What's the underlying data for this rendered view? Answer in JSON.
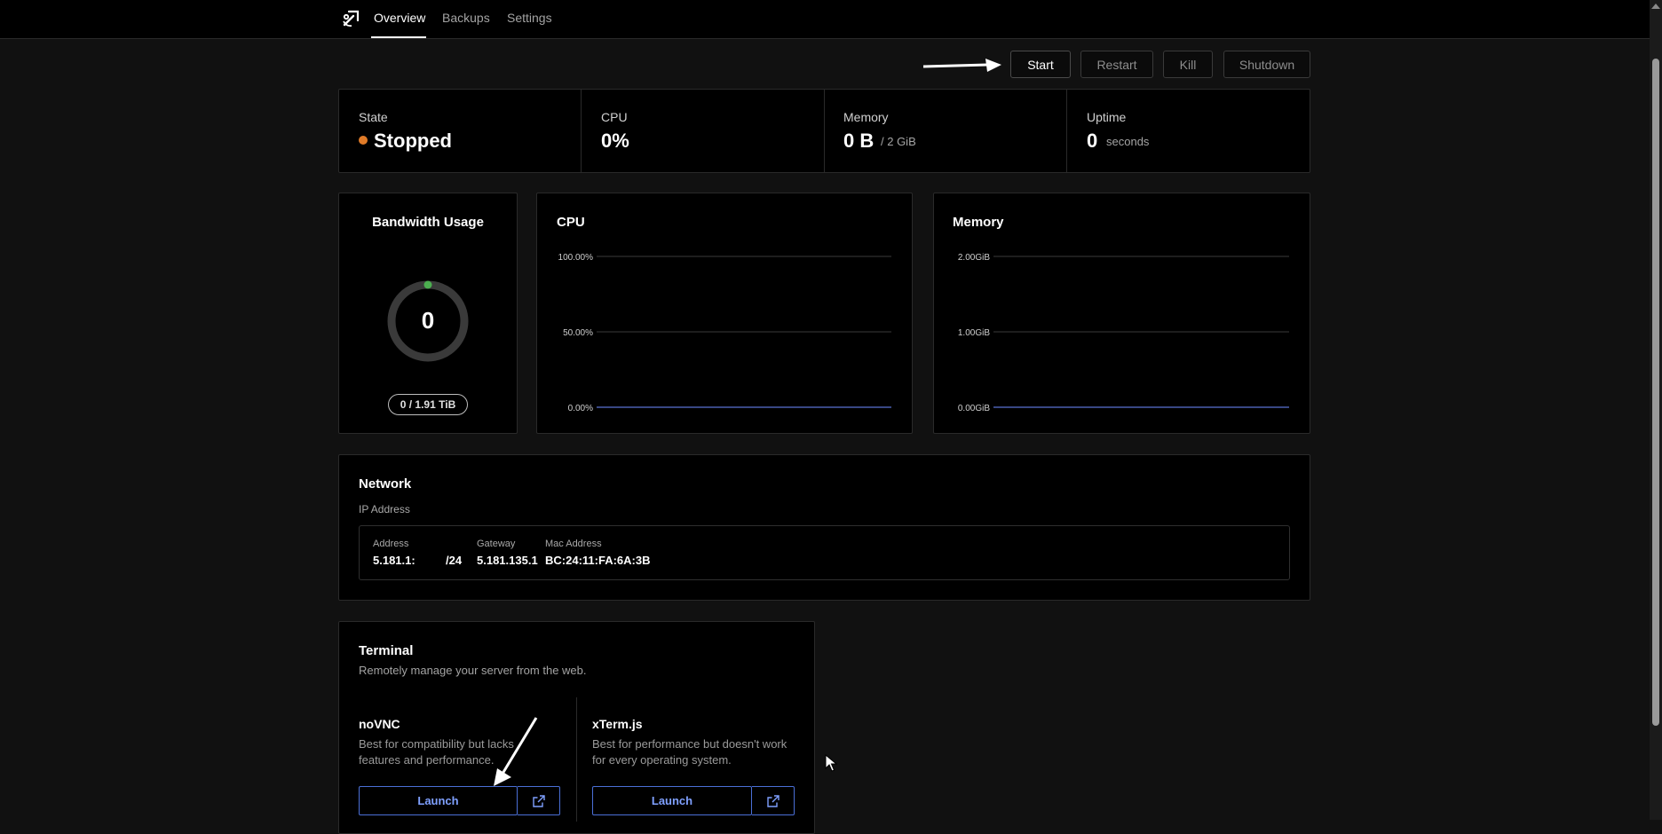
{
  "nav": {
    "tabs": [
      {
        "label": "Overview",
        "active": true
      },
      {
        "label": "Backups",
        "active": false
      },
      {
        "label": "Settings",
        "active": false
      }
    ]
  },
  "power": {
    "start": "Start",
    "restart": "Restart",
    "kill": "Kill",
    "shutdown": "Shutdown"
  },
  "stats": {
    "state": {
      "label": "State",
      "value": "Stopped",
      "dot_color": "#e07b28"
    },
    "cpu": {
      "label": "CPU",
      "value": "0%"
    },
    "memory": {
      "label": "Memory",
      "value": "0 B",
      "sub": "/ 2 GiB"
    },
    "uptime": {
      "label": "Uptime",
      "value": "0",
      "sub": "seconds"
    }
  },
  "bandwidth": {
    "title": "Bandwidth Usage",
    "value": "0",
    "usage": "0 / 1.91 TiB"
  },
  "chart_data": [
    {
      "type": "line",
      "title": "CPU",
      "yticks": [
        "100.00%",
        "50.00%",
        "0.00%"
      ],
      "ylim": [
        0,
        100
      ],
      "series": [
        {
          "values": [
            0,
            0
          ]
        }
      ]
    },
    {
      "type": "line",
      "title": "Memory",
      "yticks": [
        "2.00GiB",
        "1.00GiB",
        "0.00GiB"
      ],
      "ylim": [
        0,
        2
      ],
      "series": [
        {
          "values": [
            0,
            0
          ]
        }
      ]
    }
  ],
  "network": {
    "title": "Network",
    "subtitle": "IP Address",
    "address_label": "Address",
    "address_value": "5.181.1:",
    "address_suffix": "/24",
    "gateway_label": "Gateway",
    "gateway_value": "5.181.135.1",
    "mac_label": "Mac Address",
    "mac_value": "BC:24:11:FA:6A:3B"
  },
  "terminal": {
    "title": "Terminal",
    "subtitle": "Remotely manage your server from the web.",
    "novnc": {
      "title": "noVNC",
      "desc": "Best for compatibility but lacks features and performance.",
      "launch": "Launch"
    },
    "xterm": {
      "title": "xTerm.js",
      "desc": "Best for performance but doesn't work for every operating system.",
      "launch": "Launch"
    }
  },
  "colors": {
    "accent": "#4a6fd6",
    "state_stopped": "#e07b28",
    "bandwidth_dot": "#4caf50"
  }
}
